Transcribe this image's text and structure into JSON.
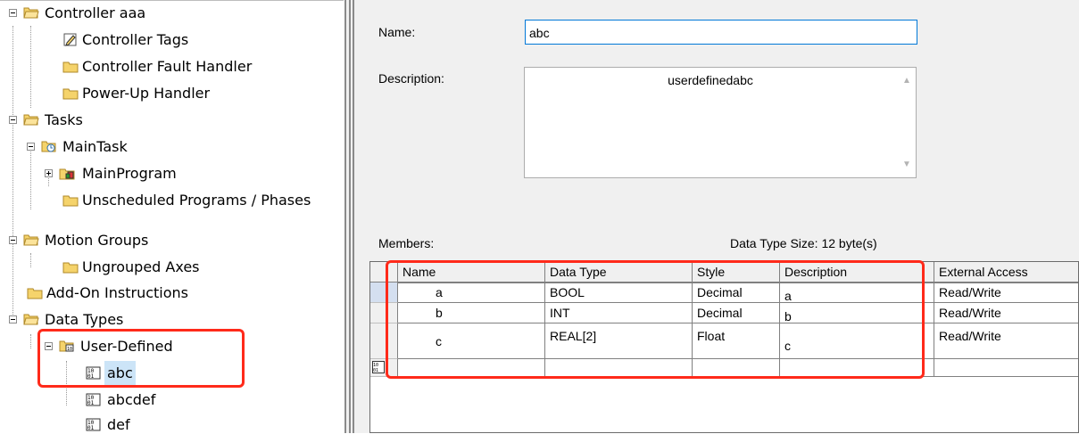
{
  "tree": {
    "controller": "Controller aaa",
    "controller_tags": "Controller Tags",
    "fault_handler": "Controller Fault Handler",
    "powerup_handler": "Power-Up Handler",
    "tasks": "Tasks",
    "main_task": "MainTask",
    "main_program": "MainProgram",
    "unscheduled": "Unscheduled Programs / Phases",
    "motion_groups": "Motion Groups",
    "ungrouped_axes": "Ungrouped Axes",
    "addon": "Add-On Instructions",
    "data_types": "Data Types",
    "user_defined": "User-Defined",
    "udt_items": [
      "abc",
      "abcdef",
      "def"
    ]
  },
  "form": {
    "name_label": "Name:",
    "name_value": "abc",
    "description_label": "Description:",
    "description_value": "userdefinedabc",
    "members_label": "Members:",
    "size_label": "Data Type Size: 12 byte(s)"
  },
  "members": {
    "columns": [
      "Name",
      "Data Type",
      "Style",
      "Description",
      "External Access"
    ],
    "rows": [
      {
        "name": "a",
        "type": "BOOL",
        "style": "Decimal",
        "description": "a",
        "access": "Read/Write"
      },
      {
        "name": "b",
        "type": "INT",
        "style": "Decimal",
        "description": "b",
        "access": "Read/Write"
      },
      {
        "name": "c",
        "type": "REAL[2]",
        "style": "Float",
        "description": "c",
        "access": "Read/Write"
      }
    ]
  },
  "colors": {
    "highlight": "#ff2a1a",
    "selection": "#cce4f7",
    "folder": "#f5d36b"
  }
}
